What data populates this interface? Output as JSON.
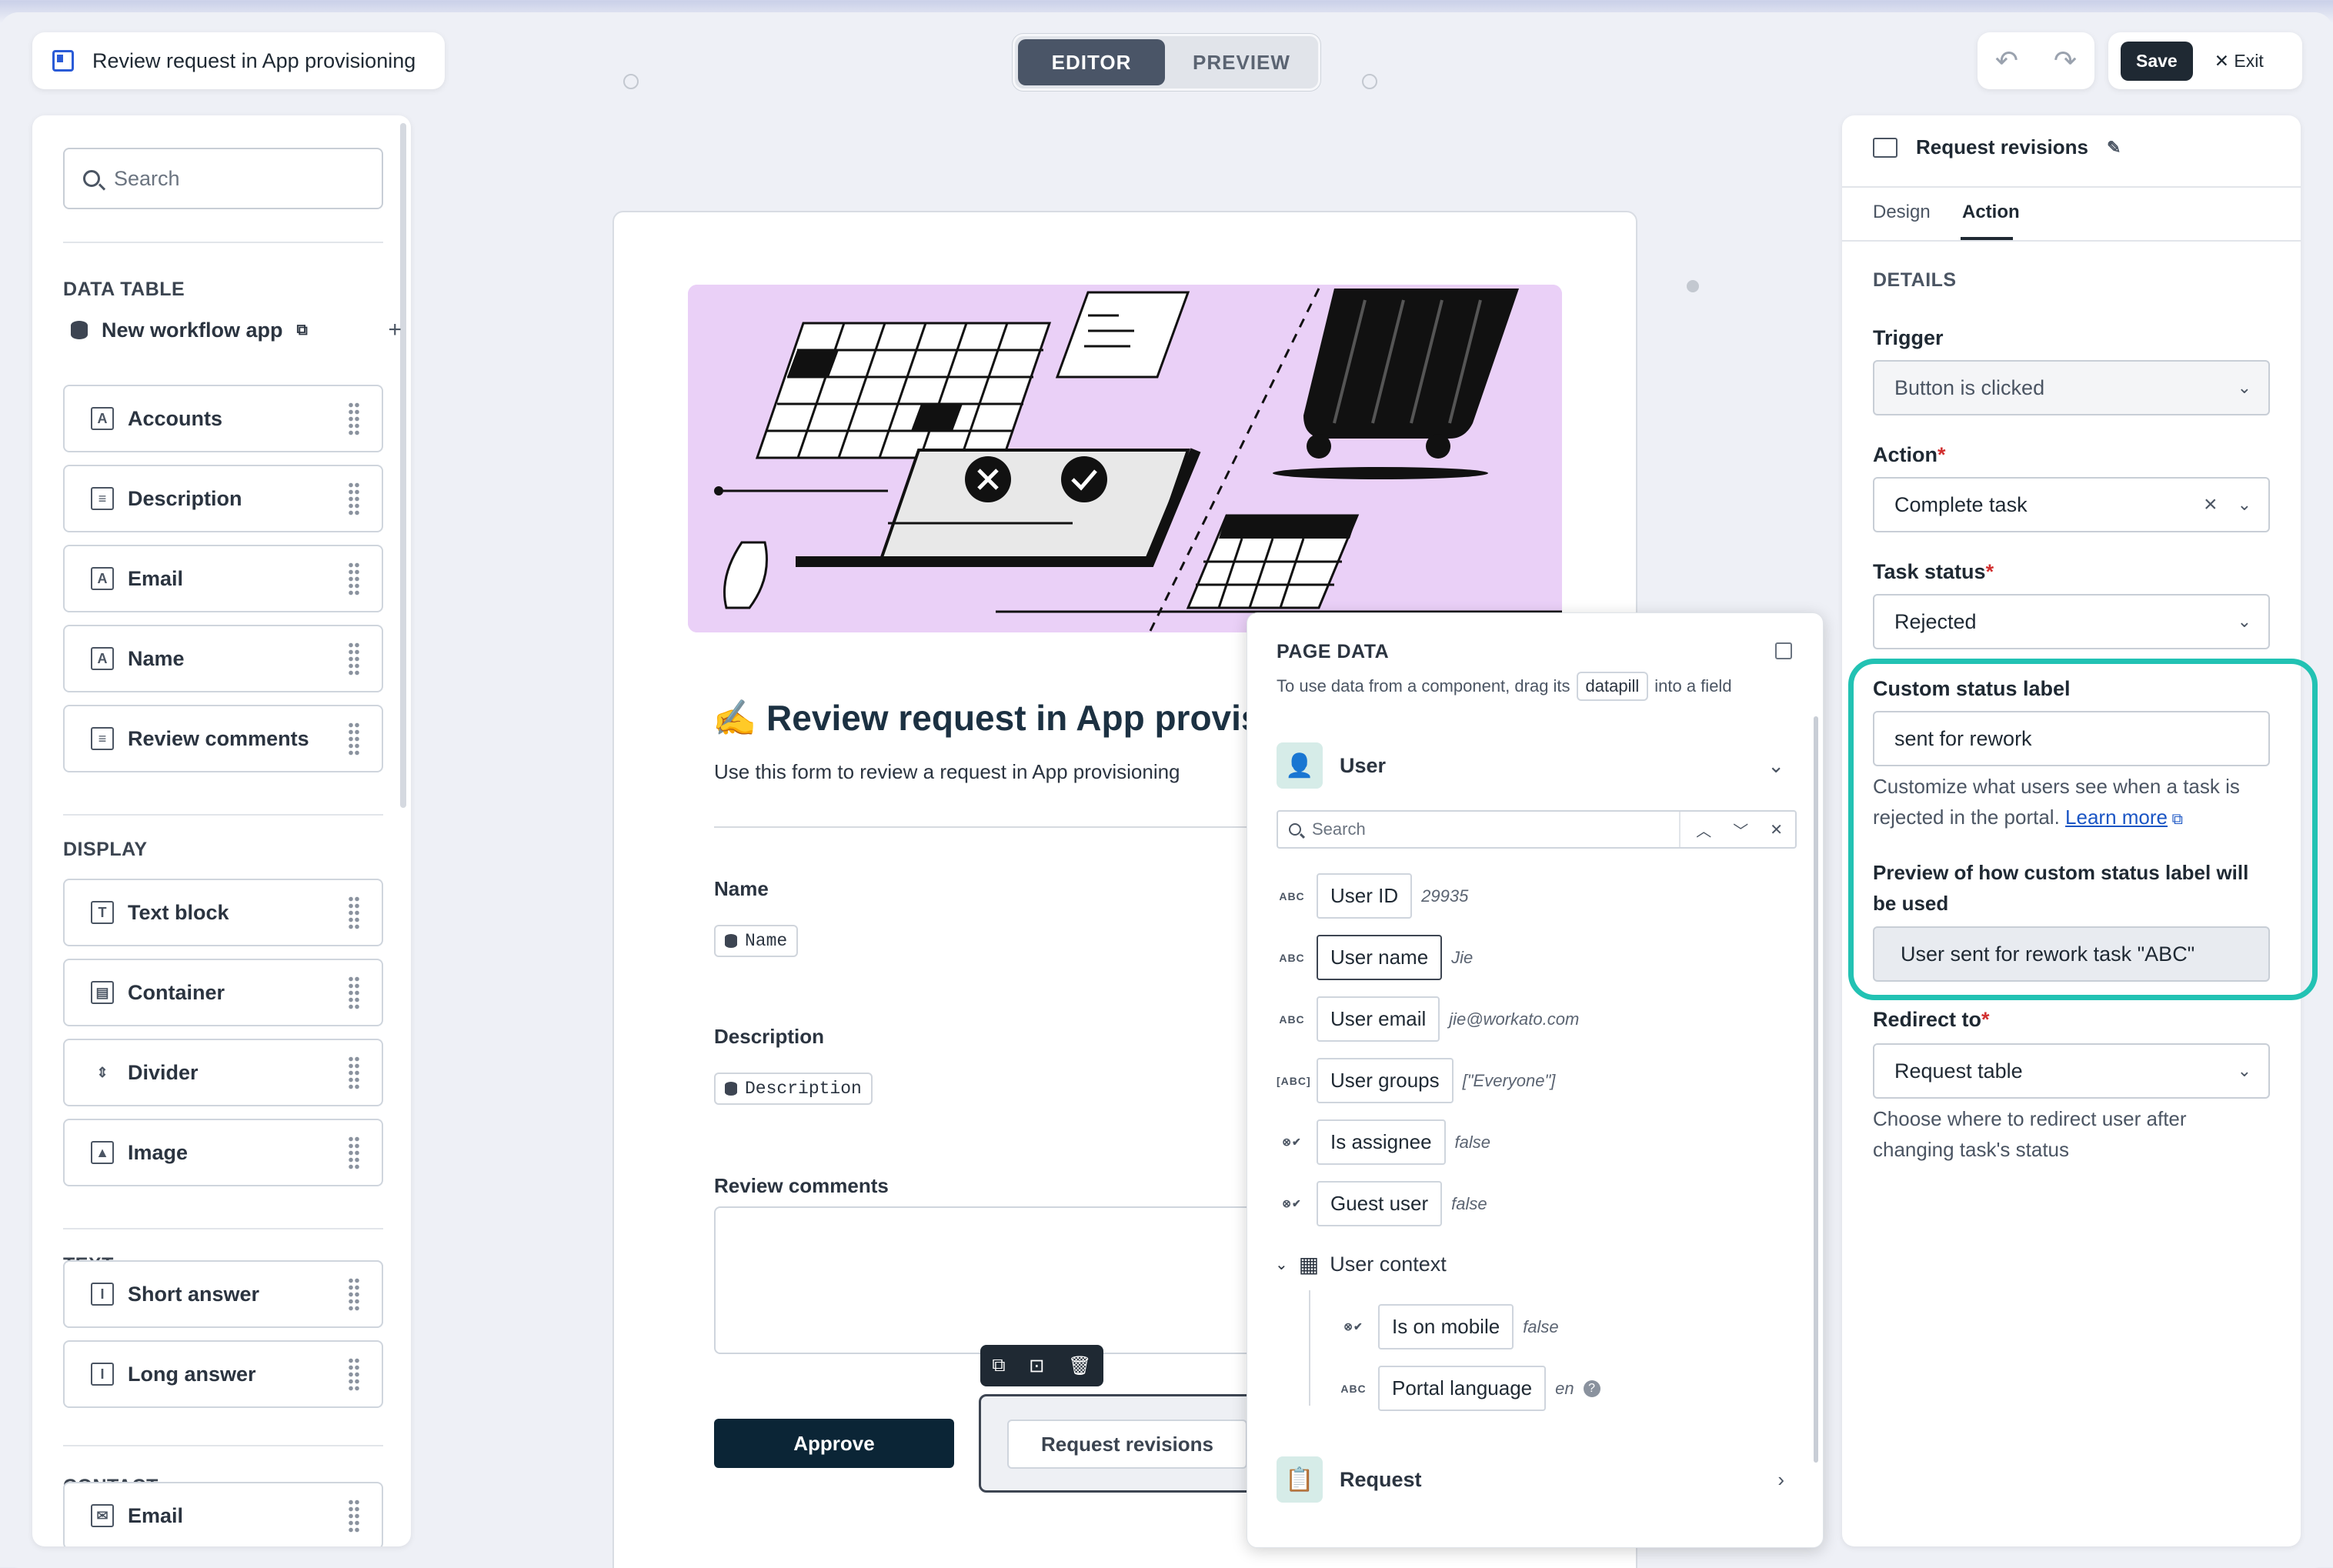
{
  "header": {
    "app_title": "Review request in App provisioning",
    "mode_editor": "EDITOR",
    "mode_preview": "PREVIEW",
    "undo_icon": "undo-icon",
    "redo_icon": "redo-icon",
    "save_label": "Save",
    "exit_label": "Exit"
  },
  "left_panel": {
    "search_placeholder": "Search",
    "data_table": {
      "section_label": "DATA TABLE",
      "source_name": "New workflow app",
      "items": [
        "Accounts",
        "Description",
        "Email",
        "Name",
        "Review comments"
      ]
    },
    "display": {
      "section_label": "DISPLAY",
      "items": [
        "Text block",
        "Container",
        "Divider",
        "Image"
      ]
    },
    "text": {
      "section_label": "TEXT",
      "items": [
        "Short answer",
        "Long answer"
      ]
    },
    "contact": {
      "section_label": "CONTACT",
      "items": [
        "Email"
      ]
    }
  },
  "form": {
    "title": "✍️ Review request in App provisi",
    "subtitle": "Use this form to review a request in App provisioning",
    "name_label": "Name",
    "name_pill": "Name",
    "description_label": "Description",
    "description_pill": "Description",
    "review_label": "Review comments",
    "approve_label": "Approve",
    "request_revisions_label": "Request revisions"
  },
  "page_data": {
    "title": "PAGE DATA",
    "subtitle_before": "To use data from a component, drag its",
    "subtitle_tag": "datapill",
    "subtitle_after": "into a field",
    "user_section": "User",
    "search_placeholder": "Search",
    "fields": [
      {
        "type": "ABC",
        "name": "User ID",
        "value": "29935"
      },
      {
        "type": "ABC",
        "name": "User name",
        "value": "Jie"
      },
      {
        "type": "ABC",
        "name": "User email",
        "value": "jie@workato.com"
      },
      {
        "type": "[ABC]",
        "name": "User groups",
        "value": "[\"Everyone\"]"
      },
      {
        "type": "bool",
        "name": "Is assignee",
        "value": "false"
      },
      {
        "type": "bool",
        "name": "Guest user",
        "value": "false"
      }
    ],
    "user_context_label": "User context",
    "context_fields": [
      {
        "type": "bool",
        "name": "Is on mobile",
        "value": "false"
      },
      {
        "type": "ABC",
        "name": "Portal language",
        "value": "en"
      }
    ],
    "request_section": "Request"
  },
  "right_panel": {
    "component_name": "Request revisions",
    "tab_design": "Design",
    "tab_action": "Action",
    "details_label": "DETAILS",
    "trigger_label": "Trigger",
    "trigger_value": "Button is clicked",
    "action_label": "Action",
    "action_value": "Complete task",
    "task_status_label": "Task status",
    "task_status_value": "Rejected",
    "custom_status_label": "Custom status label",
    "custom_status_value": "sent for rework",
    "custom_status_help": "Customize what users see when a task is rejected in the portal.",
    "learn_more": "Learn more",
    "preview_label": "Preview of how custom status label will be used",
    "preview_value": "User sent for rework task \"ABC\"",
    "redirect_label": "Redirect to",
    "redirect_value": "Request table",
    "redirect_help": "Choose where to redirect user after changing task's status",
    "required_mark": "*"
  },
  "colors": {
    "accent_highlight": "#22c2b3",
    "primary_button": "#0b2536",
    "hero_background": "#ead0f7",
    "link": "#1a55c4",
    "required": "#d12f2f"
  }
}
